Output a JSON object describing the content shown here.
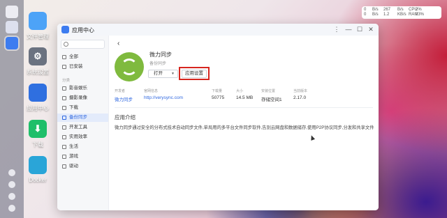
{
  "desktop": {
    "icons": [
      {
        "label": "文件管理",
        "icon": "folder-icon"
      },
      {
        "label": "系统设置",
        "icon": "gear-icon"
      },
      {
        "label": "应用中心",
        "icon": "store-icon"
      },
      {
        "label": "下载",
        "icon": "download-icon"
      },
      {
        "label": "Docker",
        "icon": "docker-icon"
      }
    ],
    "status": {
      "rows": [
        {
          "v1": "0",
          "u1": "B/s",
          "v2": "267",
          "u2": "B/s",
          "k": "CPU",
          "p": "2%"
        },
        {
          "v1": "0",
          "u1": "B/s",
          "v2": "1.2",
          "u2": "KB/s",
          "k": "RAM",
          "p": "23%"
        }
      ]
    }
  },
  "window": {
    "title": "应用中心",
    "controls": {
      "minimize": "—",
      "maximize": "☐",
      "close": "✕"
    }
  },
  "sidebar": {
    "search_placeholder": "",
    "items_top": [
      {
        "label": "全部"
      },
      {
        "label": "已安装"
      }
    ],
    "section_label": "分类",
    "items": [
      {
        "label": "影音娱乐"
      },
      {
        "label": "摄影录像"
      },
      {
        "label": "下载"
      },
      {
        "label": "备份同步"
      },
      {
        "label": "开发工具"
      },
      {
        "label": "实用效率"
      },
      {
        "label": "生活"
      },
      {
        "label": "游戏"
      },
      {
        "label": "驱动"
      }
    ],
    "active_item": "备份同步"
  },
  "app": {
    "back_icon": "chevron-left-icon",
    "name": "微力同步",
    "category": "备份同步",
    "open_label": "打开",
    "settings_label": "应用设置",
    "brand_color": "#7fba3e",
    "highlight_color": "#d6261f",
    "info": [
      {
        "key": "开发者",
        "value": "微力同步",
        "link": true
      },
      {
        "key": "官网信息",
        "value": "http://verysync.com",
        "link": true
      },
      {
        "key": "下载量",
        "value": "50775",
        "link": false
      },
      {
        "key": "大小",
        "value": "14.5 MB",
        "link": false
      },
      {
        "key": "安装位置",
        "value": "存储空间1",
        "link": false
      },
      {
        "key": "当前版本",
        "value": "2.17.0",
        "link": false
      }
    ],
    "intro_title": "应用介绍",
    "intro_text": "微力同步通过安全的分布式技术自动同步文件,单局用的多平台文件同步软件,告别云网盘和数据储存,使用P2P协议同步,分发和共享文件"
  }
}
